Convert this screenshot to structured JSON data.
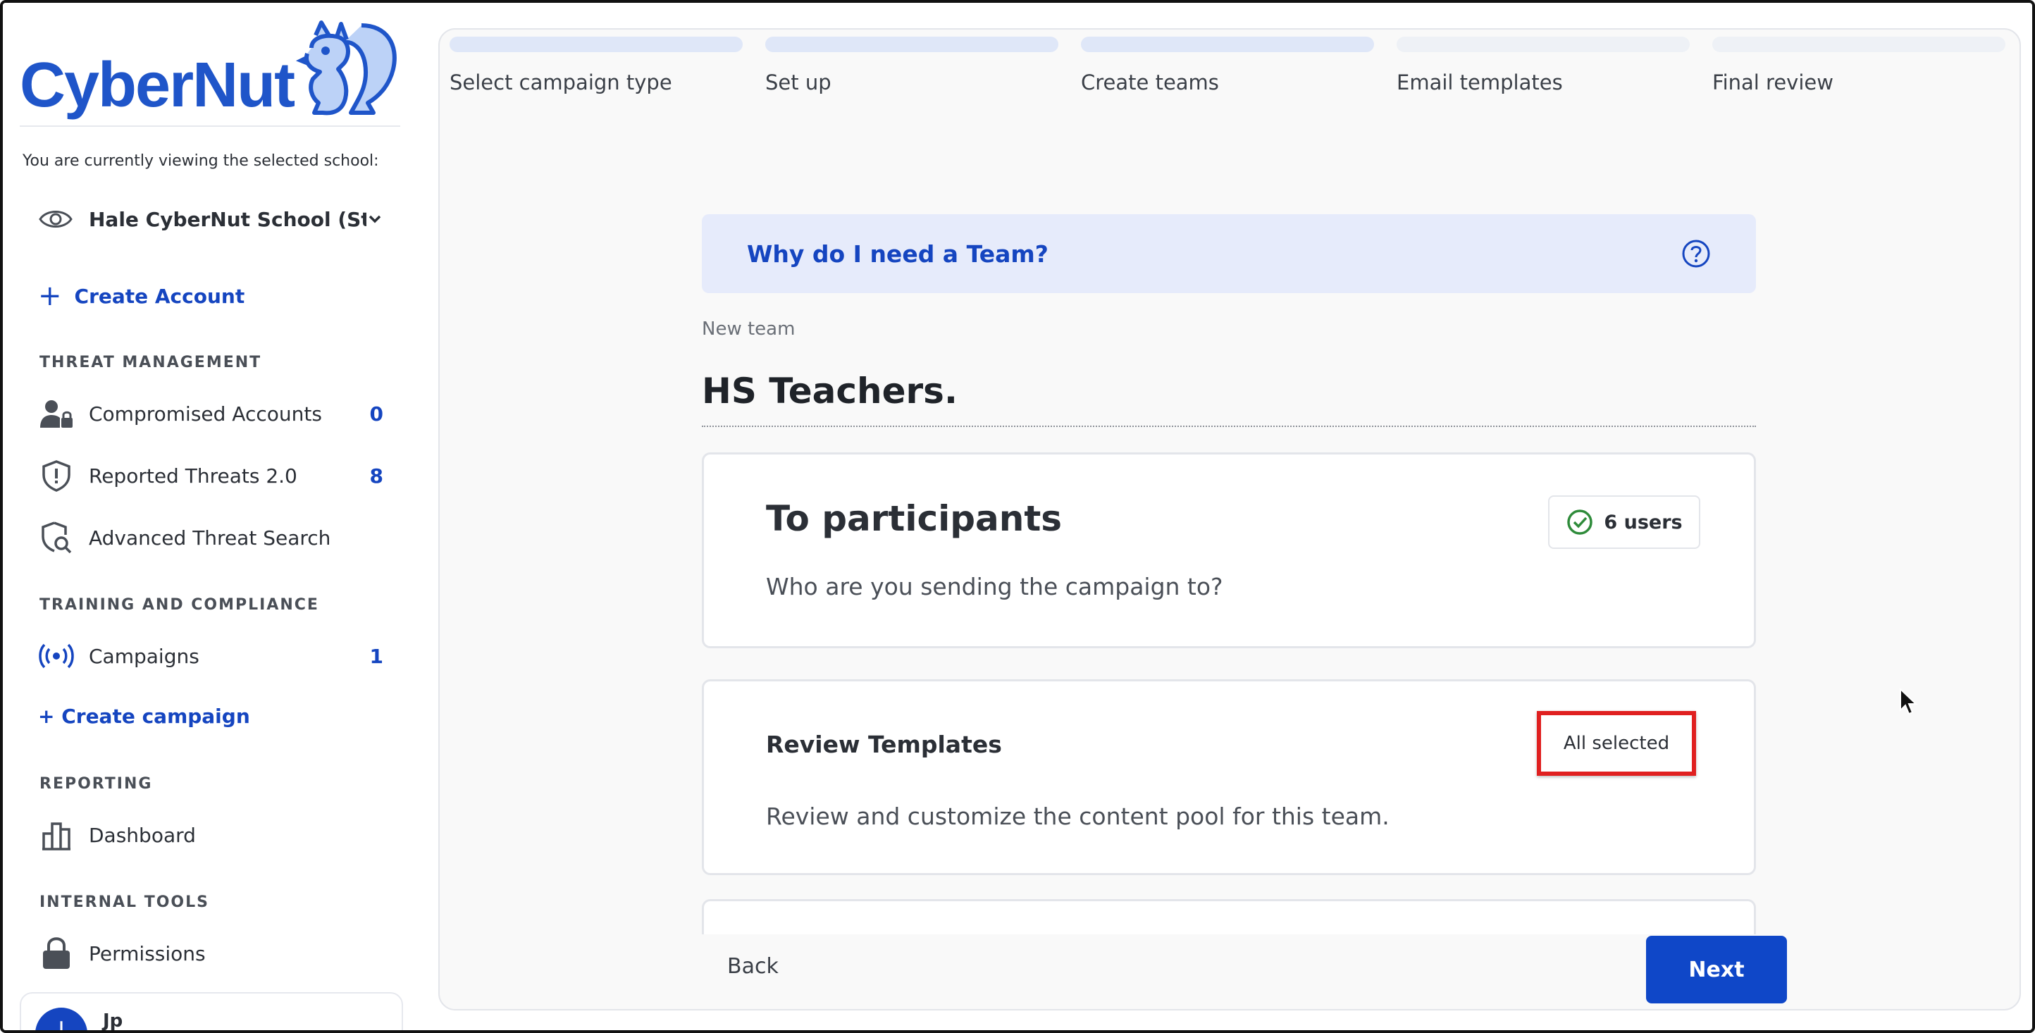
{
  "brand": {
    "name": "CyberNut"
  },
  "sidebar": {
    "viewing_label": "You are currently viewing the selected school:",
    "school_name": "Hale CyberNut School (St...",
    "create_account": "Create Account",
    "sections": {
      "threat": "THREAT MANAGEMENT",
      "training": "TRAINING AND COMPLIANCE",
      "reporting": "REPORTING",
      "internal": "INTERNAL TOOLS"
    },
    "items": {
      "compromised": {
        "label": "Compromised Accounts",
        "count": "0"
      },
      "reported": {
        "label": "Reported Threats 2.0",
        "count": "8"
      },
      "advanced": {
        "label": "Advanced Threat Search"
      },
      "campaigns": {
        "label": "Campaigns",
        "count": "1"
      },
      "dashboard": {
        "label": "Dashboard"
      },
      "permissions": {
        "label": "Permissions"
      }
    },
    "create_campaign": "+ Create campaign",
    "user": {
      "initial": "J",
      "name": "Jp"
    }
  },
  "stepper": {
    "steps": [
      {
        "label": "Select campaign type"
      },
      {
        "label": "Set up"
      },
      {
        "label": "Create teams"
      },
      {
        "label": "Email templates"
      },
      {
        "label": "Final review"
      }
    ]
  },
  "main": {
    "faq_question": "Why do I need a Team?",
    "new_team_label": "New team",
    "team_name": "HS Teachers.",
    "participants_card": {
      "title": "To participants",
      "subtitle": "Who are you sending the campaign to?",
      "badge": "6 users"
    },
    "templates_card": {
      "title": "Review Templates",
      "subtitle": "Review and customize the content pool for this team.",
      "badge": "All selected"
    },
    "back_label": "Back",
    "next_label": "Next"
  },
  "colors": {
    "accent": "#1545c0",
    "highlight_border": "#e02020",
    "faq_bg": "#e6ebfb",
    "next_button": "#0f47c8"
  }
}
